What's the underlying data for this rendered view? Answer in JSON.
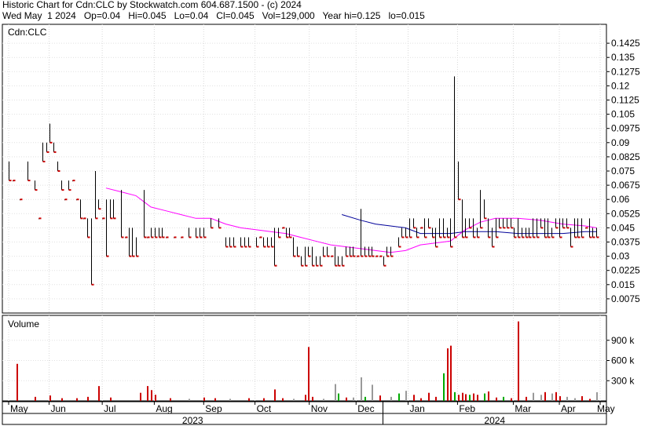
{
  "header": {
    "line1": "Historic Chart for Cdn:CLC by Stockwatch.com 604.687.1500 - (c) 2024",
    "line2": "Wed May  1 2024   Op=0.04   Hi=0.045   Lo=0.04   Cl=0.045   Vol=129,000   Year hi=0.125   lo=0.015"
  },
  "chart_data": [
    {
      "type": "ohlc",
      "panel": "price",
      "title": "Cdn:CLC",
      "y_ticks": [
        "0.1425",
        "0.135",
        "0.1275",
        "0.12",
        "0.1125",
        "0.105",
        "0.0975",
        "0.09",
        "0.0825",
        "0.075",
        "0.0675",
        "0.06",
        "0.0525",
        "0.045",
        "0.0375",
        "0.03",
        "0.0225",
        "0.015",
        "0.0075"
      ],
      "ylim": [
        0,
        0.15
      ],
      "grid": true,
      "colors": {
        "bar": "#000000",
        "close_tick": "#cc0000",
        "ma_short": "#ff00ff",
        "ma_long": "#000099"
      },
      "bars": [
        [
          0,
          0.08,
          0.07
        ],
        [
          1,
          0.07,
          0.07
        ],
        [
          3,
          0.06,
          0.06
        ],
        [
          5,
          0.08,
          0.07
        ],
        [
          7,
          0.07,
          0.065
        ],
        [
          8,
          0.05,
          0.05
        ],
        [
          9,
          0.09,
          0.08
        ],
        [
          10,
          0.09,
          0.085
        ],
        [
          11,
          0.1,
          0.09
        ],
        [
          12,
          0.09,
          0.085
        ],
        [
          13,
          0.08,
          0.075
        ],
        [
          14,
          0.07,
          0.065
        ],
        [
          15,
          0.06,
          0.06
        ],
        [
          16,
          0.07,
          0.065
        ],
        [
          17,
          0.07,
          0.07
        ],
        [
          18,
          0.06,
          0.06
        ],
        [
          19,
          0.06,
          0.05
        ],
        [
          20,
          0.05,
          0.05
        ],
        [
          21,
          0.05,
          0.04
        ],
        [
          22,
          0.05,
          0.015
        ],
        [
          23,
          0.075,
          0.05
        ],
        [
          24,
          0.06,
          0.055
        ],
        [
          25,
          0.05,
          0.05
        ],
        [
          26,
          0.06,
          0.03
        ],
        [
          27,
          0.06,
          0.05
        ],
        [
          28,
          0.06,
          0.05
        ],
        [
          30,
          0.065,
          0.04
        ],
        [
          31,
          0.04,
          0.04
        ],
        [
          32,
          0.045,
          0.03
        ],
        [
          33,
          0.045,
          0.03
        ],
        [
          34,
          0.04,
          0.03
        ],
        [
          36,
          0.065,
          0.04
        ],
        [
          37,
          0.04,
          0.04
        ],
        [
          38,
          0.045,
          0.04
        ],
        [
          39,
          0.045,
          0.04
        ],
        [
          40,
          0.045,
          0.04
        ],
        [
          41,
          0.045,
          0.04
        ],
        [
          42,
          0.04,
          0.04
        ],
        [
          44,
          0.04,
          0.04
        ],
        [
          46,
          0.04,
          0.04
        ],
        [
          48,
          0.045,
          0.04
        ],
        [
          50,
          0.045,
          0.04
        ],
        [
          51,
          0.045,
          0.04
        ],
        [
          52,
          0.045,
          0.04
        ],
        [
          54,
          0.05,
          0.045
        ],
        [
          56,
          0.05,
          0.045
        ],
        [
          58,
          0.04,
          0.035
        ],
        [
          59,
          0.04,
          0.035
        ],
        [
          60,
          0.04,
          0.035
        ],
        [
          62,
          0.04,
          0.035
        ],
        [
          63,
          0.04,
          0.035
        ],
        [
          64,
          0.04,
          0.035
        ],
        [
          66,
          0.04,
          0.035
        ],
        [
          67,
          0.04,
          0.04
        ],
        [
          68,
          0.04,
          0.035
        ],
        [
          69,
          0.04,
          0.035
        ],
        [
          70,
          0.04,
          0.035
        ],
        [
          71,
          0.045,
          0.025
        ],
        [
          72,
          0.045,
          0.04
        ],
        [
          73,
          0.045,
          0.045
        ],
        [
          74,
          0.045,
          0.04
        ],
        [
          75,
          0.045,
          0.04
        ],
        [
          76,
          0.04,
          0.03
        ],
        [
          77,
          0.035,
          0.03
        ],
        [
          78,
          0.03,
          0.025
        ],
        [
          79,
          0.035,
          0.025
        ],
        [
          80,
          0.035,
          0.03
        ],
        [
          81,
          0.035,
          0.025
        ],
        [
          82,
          0.03,
          0.025
        ],
        [
          83,
          0.03,
          0.025
        ],
        [
          84,
          0.035,
          0.03
        ],
        [
          85,
          0.035,
          0.03
        ],
        [
          86,
          0.03,
          0.03
        ],
        [
          87,
          0.035,
          0.025
        ],
        [
          88,
          0.03,
          0.025
        ],
        [
          89,
          0.03,
          0.025
        ],
        [
          90,
          0.035,
          0.03
        ],
        [
          91,
          0.035,
          0.03
        ],
        [
          92,
          0.035,
          0.03
        ],
        [
          93,
          0.03,
          0.03
        ],
        [
          94,
          0.055,
          0.03
        ],
        [
          95,
          0.035,
          0.03
        ],
        [
          96,
          0.035,
          0.03
        ],
        [
          97,
          0.035,
          0.03
        ],
        [
          98,
          0.03,
          0.03
        ],
        [
          99,
          0.03,
          0.03
        ],
        [
          100,
          0.03,
          0.025
        ],
        [
          101,
          0.035,
          0.03
        ],
        [
          102,
          0.035,
          0.03
        ],
        [
          104,
          0.04,
          0.035
        ],
        [
          105,
          0.045,
          0.04
        ],
        [
          106,
          0.045,
          0.04
        ],
        [
          107,
          0.05,
          0.04
        ],
        [
          108,
          0.05,
          0.045
        ],
        [
          109,
          0.045,
          0.04
        ],
        [
          110,
          0.045,
          0.045
        ],
        [
          111,
          0.05,
          0.04
        ],
        [
          112,
          0.05,
          0.045
        ],
        [
          113,
          0.045,
          0.04
        ],
        [
          114,
          0.045,
          0.035
        ],
        [
          115,
          0.05,
          0.04
        ],
        [
          116,
          0.05,
          0.04
        ],
        [
          117,
          0.045,
          0.04
        ],
        [
          118,
          0.05,
          0.035
        ],
        [
          119,
          0.125,
          0.04
        ],
        [
          120,
          0.08,
          0.06
        ],
        [
          121,
          0.06,
          0.04
        ],
        [
          122,
          0.05,
          0.04
        ],
        [
          123,
          0.05,
          0.045
        ],
        [
          124,
          0.05,
          0.04
        ],
        [
          125,
          0.045,
          0.04
        ],
        [
          126,
          0.065,
          0.045
        ],
        [
          127,
          0.06,
          0.05
        ],
        [
          128,
          0.05,
          0.04
        ],
        [
          129,
          0.045,
          0.035
        ],
        [
          130,
          0.05,
          0.04
        ],
        [
          131,
          0.05,
          0.045
        ],
        [
          132,
          0.05,
          0.045
        ],
        [
          133,
          0.05,
          0.045
        ],
        [
          134,
          0.05,
          0.045
        ],
        [
          135,
          0.045,
          0.04
        ],
        [
          136,
          0.05,
          0.04
        ],
        [
          137,
          0.045,
          0.04
        ],
        [
          138,
          0.045,
          0.04
        ],
        [
          139,
          0.045,
          0.04
        ],
        [
          140,
          0.05,
          0.04
        ],
        [
          141,
          0.05,
          0.04
        ],
        [
          142,
          0.05,
          0.045
        ],
        [
          143,
          0.05,
          0.04
        ],
        [
          144,
          0.05,
          0.04
        ],
        [
          145,
          0.045,
          0.04
        ],
        [
          146,
          0.05,
          0.045
        ],
        [
          147,
          0.05,
          0.04
        ],
        [
          148,
          0.05,
          0.045
        ],
        [
          149,
          0.05,
          0.045
        ],
        [
          150,
          0.045,
          0.035
        ],
        [
          151,
          0.05,
          0.04
        ],
        [
          152,
          0.05,
          0.04
        ],
        [
          153,
          0.05,
          0.04
        ],
        [
          154,
          0.045,
          0.045
        ],
        [
          155,
          0.05,
          0.04
        ],
        [
          156,
          0.045,
          0.04
        ],
        [
          157,
          0.045,
          0.04
        ]
      ],
      "ma_short": [
        [
          26,
          0.066
        ],
        [
          30,
          0.064
        ],
        [
          34,
          0.062
        ],
        [
          38,
          0.056
        ],
        [
          42,
          0.054
        ],
        [
          46,
          0.052
        ],
        [
          50,
          0.05
        ],
        [
          54,
          0.05
        ],
        [
          58,
          0.047
        ],
        [
          62,
          0.045
        ],
        [
          66,
          0.044
        ],
        [
          70,
          0.043
        ],
        [
          74,
          0.042
        ],
        [
          78,
          0.04
        ],
        [
          82,
          0.038
        ],
        [
          86,
          0.036
        ],
        [
          90,
          0.035
        ],
        [
          94,
          0.034
        ],
        [
          98,
          0.033
        ],
        [
          102,
          0.032
        ],
        [
          106,
          0.033
        ],
        [
          110,
          0.036
        ],
        [
          114,
          0.037
        ],
        [
          118,
          0.038
        ],
        [
          122,
          0.044
        ],
        [
          126,
          0.048
        ],
        [
          130,
          0.05
        ],
        [
          136,
          0.05
        ],
        [
          142,
          0.049
        ],
        [
          148,
          0.047
        ],
        [
          154,
          0.046
        ],
        [
          157,
          0.045
        ]
      ],
      "ma_long": [
        [
          89,
          0.052
        ],
        [
          94,
          0.049
        ],
        [
          98,
          0.047
        ],
        [
          102,
          0.046
        ],
        [
          106,
          0.045
        ],
        [
          110,
          0.042
        ],
        [
          114,
          0.042
        ],
        [
          118,
          0.042
        ],
        [
          122,
          0.043
        ],
        [
          126,
          0.043
        ],
        [
          130,
          0.043
        ],
        [
          136,
          0.042
        ],
        [
          142,
          0.042
        ],
        [
          148,
          0.042
        ],
        [
          154,
          0.043
        ],
        [
          157,
          0.043
        ]
      ]
    },
    {
      "type": "bar",
      "panel": "volume",
      "title": "Volume",
      "y_ticks": [
        "900 k",
        "600 k",
        "300 k"
      ],
      "ylim": [
        0,
        1200000
      ],
      "grid": true,
      "colors": {
        "up": "#00aa00",
        "down": "#cc0000",
        "flat": "#999999"
      },
      "volumes": [
        [
          2,
          550000,
          "down"
        ],
        [
          7,
          60000,
          "down"
        ],
        [
          11,
          80000,
          "down"
        ],
        [
          14,
          40000,
          "down"
        ],
        [
          18,
          40000,
          "down"
        ],
        [
          21,
          60000,
          "down"
        ],
        [
          24,
          220000,
          "down"
        ],
        [
          27,
          50000,
          "down"
        ],
        [
          35,
          120000,
          "down"
        ],
        [
          37,
          220000,
          "down"
        ],
        [
          38,
          160000,
          "down"
        ],
        [
          39,
          90000,
          "down"
        ],
        [
          43,
          40000,
          "down"
        ],
        [
          48,
          30000,
          "flat"
        ],
        [
          52,
          50000,
          "down"
        ],
        [
          55,
          40000,
          "down"
        ],
        [
          59,
          30000,
          "flat"
        ],
        [
          64,
          40000,
          "down"
        ],
        [
          68,
          40000,
          "down"
        ],
        [
          71,
          170000,
          "down"
        ],
        [
          73,
          40000,
          "down"
        ],
        [
          76,
          30000,
          "flat"
        ],
        [
          79,
          90000,
          "down"
        ],
        [
          80,
          800000,
          "down"
        ],
        [
          81,
          60000,
          "down"
        ],
        [
          84,
          30000,
          "flat"
        ],
        [
          87,
          250000,
          "flat"
        ],
        [
          88,
          110000,
          "up"
        ],
        [
          90,
          50000,
          "down"
        ],
        [
          92,
          50000,
          "flat"
        ],
        [
          94,
          350000,
          "flat"
        ],
        [
          95,
          60000,
          "up"
        ],
        [
          97,
          240000,
          "flat"
        ],
        [
          99,
          80000,
          "down"
        ],
        [
          102,
          60000,
          "flat"
        ],
        [
          104,
          110000,
          "up"
        ],
        [
          106,
          150000,
          "flat"
        ],
        [
          108,
          90000,
          "down"
        ],
        [
          110,
          40000,
          "down"
        ],
        [
          112,
          120000,
          "down"
        ],
        [
          114,
          60000,
          "down"
        ],
        [
          116,
          410000,
          "up"
        ],
        [
          117,
          780000,
          "down"
        ],
        [
          118,
          820000,
          "down"
        ],
        [
          119,
          130000,
          "up"
        ],
        [
          120,
          90000,
          "down"
        ],
        [
          121,
          120000,
          "down"
        ],
        [
          122,
          100000,
          "down"
        ],
        [
          123,
          90000,
          "up"
        ],
        [
          124,
          110000,
          "down"
        ],
        [
          125,
          90000,
          "down"
        ],
        [
          127,
          110000,
          "up"
        ],
        [
          128,
          140000,
          "down"
        ],
        [
          130,
          50000,
          "down"
        ],
        [
          132,
          60000,
          "up"
        ],
        [
          134,
          40000,
          "down"
        ],
        [
          136,
          1180000,
          "down"
        ],
        [
          138,
          60000,
          "down"
        ],
        [
          140,
          120000,
          "flat"
        ],
        [
          142,
          90000,
          "flat"
        ],
        [
          143,
          130000,
          "down"
        ],
        [
          145,
          110000,
          "flat"
        ],
        [
          146,
          130000,
          "down"
        ],
        [
          147,
          70000,
          "down"
        ],
        [
          149,
          60000,
          "flat"
        ],
        [
          151,
          40000,
          "flat"
        ],
        [
          153,
          70000,
          "down"
        ],
        [
          155,
          30000,
          "down"
        ],
        [
          157,
          129000,
          "flat"
        ]
      ]
    }
  ],
  "x_axis": {
    "months": [
      {
        "label": "May",
        "x": 0.0
      },
      {
        "label": "Jun",
        "x": 10.8
      },
      {
        "label": "Jul",
        "x": 25.0
      },
      {
        "label": "Aug",
        "x": 38.9
      },
      {
        "label": "Sep",
        "x": 52.1
      },
      {
        "label": "Oct",
        "x": 65.8
      },
      {
        "label": "Nov",
        "x": 80.3
      },
      {
        "label": "Dec",
        "x": 92.8
      },
      {
        "label": "Jan",
        "x": 106.7
      },
      {
        "label": "Feb",
        "x": 119.9
      },
      {
        "label": "Mar",
        "x": 134.8
      },
      {
        "label": "Apr",
        "x": 147.1
      },
      {
        "label": "May",
        "x": 158.0
      }
    ],
    "years": [
      {
        "label": "2023"
      },
      {
        "label": "2024"
      }
    ],
    "x_range": [
      0,
      158
    ]
  }
}
